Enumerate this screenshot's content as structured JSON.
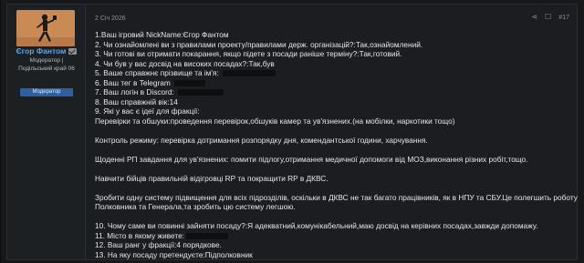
{
  "user": {
    "name": "Єгор Фантом",
    "title": "Модератор |",
    "title_line2": "Подільський край 06",
    "badge": "Модератор"
  },
  "post": {
    "date": "2 Січ 2026",
    "number": "#17",
    "lines": [
      "1.Ваш ігровий NickName:Єгор Фантом",
      "2. Чи ознайомлені ви з правилами проекту/правилами держ. організацій?:Так,ознайомлений.",
      "3. Чи готові ви отримати покарання, якщо підете з посади раніше терміну?:Так,готовий.",
      "4. Чи був у вас досвід на високих посадах?:Так,був",
      "5. Ваше справжнє прізвище та ім'я:",
      "6. Ваш тег в Telegram",
      "7. Ваш логін в Discord:",
      "8. Ваш справжній вік:14",
      "9. Які у вас є ідеї для фракції:",
      "Перевірки та обшуки:проведення перевірок,обшуків камер та ув'язнених.(на мобілки, наркотики тощо)",
      "",
      "Контроль режиму: перевірка дотримання розпорядку дня, комендантської години, харчування.",
      "",
      "Щоденні РП завдання для ув'язнених: помити підлогу,отримання медичної допомоги від МОЗ,виконання різних робіт,тощо.",
      "",
      "Навчити бійців правильній відігровці RP та покращити RP в ДКВС.",
      "",
      "Зробити одну систему підвищення для всіх підрозділів, оскільки в ДКВС не так багато працівників, як в НПУ та СБУ.Це полегшить роботу",
      "Полковника та Генерала,та зробить цю систему легшою.",
      "",
      "10. Чому саме ви повинні зайняти посаду?:Я адекватний,комунікабельний,маю досвід на керівних посадах,завжди допомажу.",
      "11. Місто в якому живете:",
      "12. Ваш ранг у фракції:4 порядкове.",
      "13. На яку посаду претендуєте:Підполковник"
    ]
  },
  "colors": {
    "username": "#5aa6e6",
    "badge": "#2d5fa3",
    "background": "#1b1d20"
  }
}
